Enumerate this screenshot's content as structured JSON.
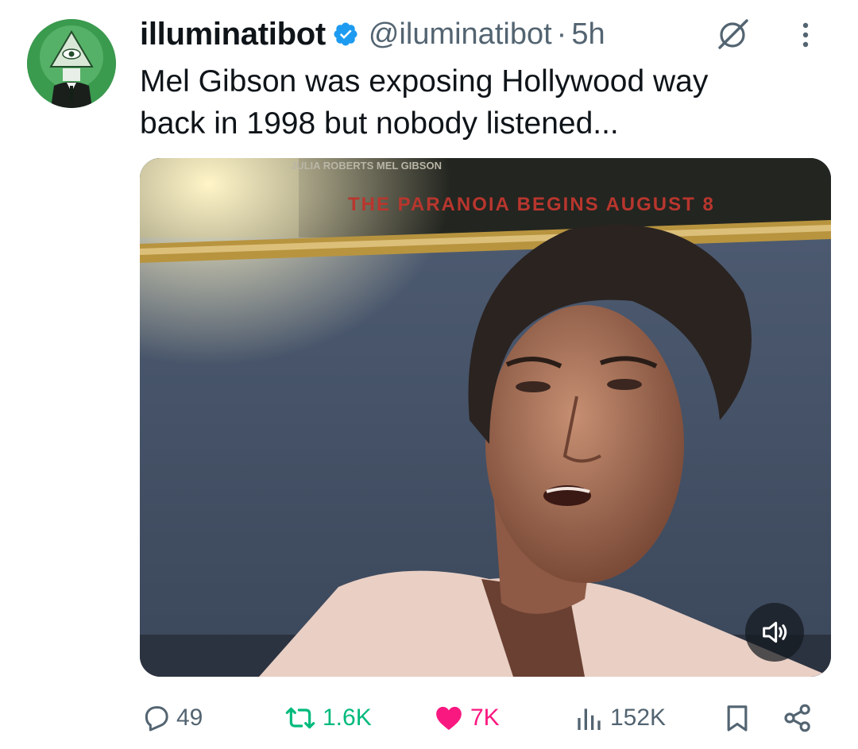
{
  "tweet": {
    "display_name": "illuminatibot",
    "handle": "@iluminatibot",
    "separator": "·",
    "time": "5h",
    "text_line1": "Mel Gibson was exposing Hollywood way",
    "text_line2": "back in 1998 but nobody listened...",
    "media": {
      "poster_text": "THE PARANOIA BEGINS AUGUST 8",
      "poster_credits": "JULIA ROBERTS  MEL GIBSON",
      "muted": true
    }
  },
  "actions": {
    "replies": "49",
    "reposts": "1.6K",
    "likes": "7K",
    "views": "152K"
  },
  "icons": {
    "verified": "verified-badge-icon",
    "grok": "grok-icon",
    "more": "more-icon",
    "mute": "speaker-muted-icon",
    "reply": "reply-icon",
    "repost": "repost-icon",
    "like": "heart-icon",
    "views": "views-icon",
    "bookmark": "bookmark-icon",
    "share": "share-icon"
  },
  "colors": {
    "verified_blue": "#1d9bf0",
    "repost_green": "#00ba7c",
    "like_pink": "#f91880",
    "muted_gray": "#536471"
  }
}
